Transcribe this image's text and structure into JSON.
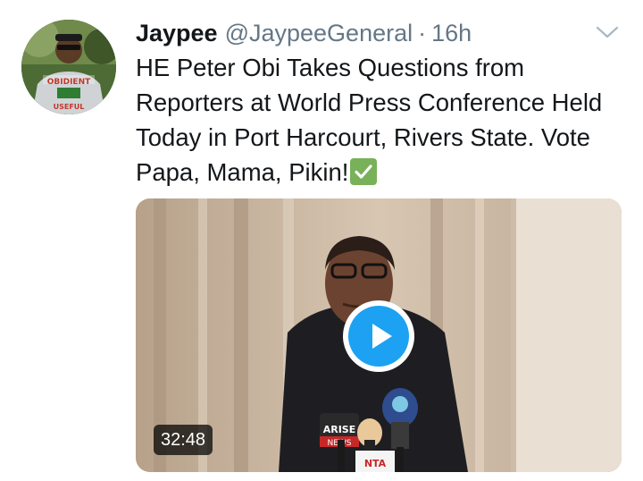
{
  "tweet": {
    "author_name": "Jaypee",
    "author_handle": "@JaypeeGeneral",
    "separator": "·",
    "timestamp": "16h",
    "text": "HE Peter Obi Takes Questions from Reporters at World Press Conference Held Today in Port Harcourt, Rivers State. Vote Papa, Mama, Pikin!",
    "trailing_emoji": "white-heavy-check-mark",
    "avatar_shirt_text_top": "OBIDIENT",
    "avatar_shirt_text_bottom": "USEFUL"
  },
  "media": {
    "type": "video",
    "duration": "32:48",
    "play_icon": "play-icon",
    "mic_labels": [
      "ARISE",
      "NEWS",
      "NTA"
    ]
  },
  "menu": {
    "icon": "chevron-down-icon"
  },
  "colors": {
    "accent": "#1da1f2",
    "secondary_text": "#657786",
    "primary_text": "#14171a",
    "check_green": "#78b159"
  }
}
